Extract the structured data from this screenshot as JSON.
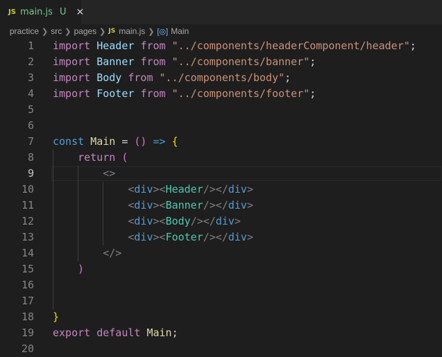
{
  "tab": {
    "badge": "JS",
    "filename": "main.js",
    "status": "U",
    "close": "✕"
  },
  "breadcrumb": {
    "items": [
      "practice",
      "src",
      "pages",
      "main.js",
      "Main"
    ],
    "file_badge": "JS",
    "symbol_icon": "symbol-variable-icon"
  },
  "editor": {
    "active_line": 9,
    "lines": [
      {
        "n": "1",
        "tokens": [
          {
            "t": "import",
            "c": "k-import"
          },
          {
            "t": " "
          },
          {
            "t": "Header",
            "c": "ident"
          },
          {
            "t": " "
          },
          {
            "t": "from",
            "c": "k-import"
          },
          {
            "t": " "
          },
          {
            "t": "\"../components/headerComponent/header\"",
            "c": "str"
          },
          {
            "t": ";",
            "c": "punct"
          }
        ]
      },
      {
        "n": "2",
        "tokens": [
          {
            "t": "import",
            "c": "k-import"
          },
          {
            "t": " "
          },
          {
            "t": "Banner",
            "c": "ident"
          },
          {
            "t": " "
          },
          {
            "t": "from",
            "c": "k-import"
          },
          {
            "t": " "
          },
          {
            "t": "\"../components/banner\"",
            "c": "str"
          },
          {
            "t": ";",
            "c": "punct"
          }
        ]
      },
      {
        "n": "3",
        "tokens": [
          {
            "t": "import",
            "c": "k-import"
          },
          {
            "t": " "
          },
          {
            "t": "Body",
            "c": "ident"
          },
          {
            "t": " "
          },
          {
            "t": "from",
            "c": "k-import"
          },
          {
            "t": " "
          },
          {
            "t": "\"../components/body\"",
            "c": "str"
          },
          {
            "t": ";",
            "c": "punct"
          }
        ]
      },
      {
        "n": "4",
        "tokens": [
          {
            "t": "import",
            "c": "k-import"
          },
          {
            "t": " "
          },
          {
            "t": "Footer",
            "c": "ident"
          },
          {
            "t": " "
          },
          {
            "t": "from",
            "c": "k-import"
          },
          {
            "t": " "
          },
          {
            "t": "\"../components/footer\"",
            "c": "str"
          },
          {
            "t": ";",
            "c": "punct"
          }
        ]
      },
      {
        "n": "5",
        "tokens": []
      },
      {
        "n": "6",
        "tokens": []
      },
      {
        "n": "7",
        "tokens": [
          {
            "t": "const",
            "c": "k-const"
          },
          {
            "t": " "
          },
          {
            "t": "Main",
            "c": "fn"
          },
          {
            "t": " = ",
            "c": "punct"
          },
          {
            "t": "()",
            "c": "paren-p"
          },
          {
            "t": " "
          },
          {
            "t": "=>",
            "c": "k-const"
          },
          {
            "t": " "
          },
          {
            "t": "{",
            "c": "brace"
          }
        ]
      },
      {
        "n": "8",
        "tokens": [
          {
            "t": "    "
          },
          {
            "t": "return",
            "c": "k-import"
          },
          {
            "t": " "
          },
          {
            "t": "(",
            "c": "paren-p"
          }
        ]
      },
      {
        "n": "9",
        "tokens": [
          {
            "t": "        "
          },
          {
            "t": "<>",
            "c": "tag"
          }
        ]
      },
      {
        "n": "10",
        "tokens": [
          {
            "t": "            "
          },
          {
            "t": "<",
            "c": "tag"
          },
          {
            "t": "div",
            "c": "tagname"
          },
          {
            "t": "><",
            "c": "tag"
          },
          {
            "t": "Header",
            "c": "comp"
          },
          {
            "t": "/></",
            "c": "tag"
          },
          {
            "t": "div",
            "c": "tagname"
          },
          {
            "t": ">",
            "c": "tag"
          }
        ]
      },
      {
        "n": "11",
        "tokens": [
          {
            "t": "            "
          },
          {
            "t": "<",
            "c": "tag"
          },
          {
            "t": "div",
            "c": "tagname"
          },
          {
            "t": "><",
            "c": "tag"
          },
          {
            "t": "Banner",
            "c": "comp"
          },
          {
            "t": "/></",
            "c": "tag"
          },
          {
            "t": "div",
            "c": "tagname"
          },
          {
            "t": ">",
            "c": "tag"
          }
        ]
      },
      {
        "n": "12",
        "tokens": [
          {
            "t": "            "
          },
          {
            "t": "<",
            "c": "tag"
          },
          {
            "t": "div",
            "c": "tagname"
          },
          {
            "t": "><",
            "c": "tag"
          },
          {
            "t": "Body",
            "c": "comp"
          },
          {
            "t": "/></",
            "c": "tag"
          },
          {
            "t": "div",
            "c": "tagname"
          },
          {
            "t": ">",
            "c": "tag"
          }
        ]
      },
      {
        "n": "13",
        "tokens": [
          {
            "t": "            "
          },
          {
            "t": "<",
            "c": "tag"
          },
          {
            "t": "div",
            "c": "tagname"
          },
          {
            "t": "><",
            "c": "tag"
          },
          {
            "t": "Footer",
            "c": "comp"
          },
          {
            "t": "/></",
            "c": "tag"
          },
          {
            "t": "div",
            "c": "tagname"
          },
          {
            "t": ">",
            "c": "tag"
          }
        ]
      },
      {
        "n": "14",
        "tokens": [
          {
            "t": "        "
          },
          {
            "t": "</>",
            "c": "tag"
          }
        ]
      },
      {
        "n": "15",
        "tokens": [
          {
            "t": "    "
          },
          {
            "t": ")",
            "c": "paren-p"
          }
        ]
      },
      {
        "n": "16",
        "tokens": []
      },
      {
        "n": "17",
        "tokens": []
      },
      {
        "n": "18",
        "tokens": [
          {
            "t": "}",
            "c": "brace"
          }
        ]
      },
      {
        "n": "19",
        "tokens": [
          {
            "t": "export",
            "c": "k-import"
          },
          {
            "t": " "
          },
          {
            "t": "default",
            "c": "k-import"
          },
          {
            "t": " "
          },
          {
            "t": "Main",
            "c": "fn"
          },
          {
            "t": ";",
            "c": "punct"
          }
        ]
      },
      {
        "n": "20",
        "tokens": []
      }
    ]
  },
  "colors": {
    "background": "#1e1e1e",
    "tab_untracked": "#73c991",
    "js_badge": "#cbcb41"
  }
}
